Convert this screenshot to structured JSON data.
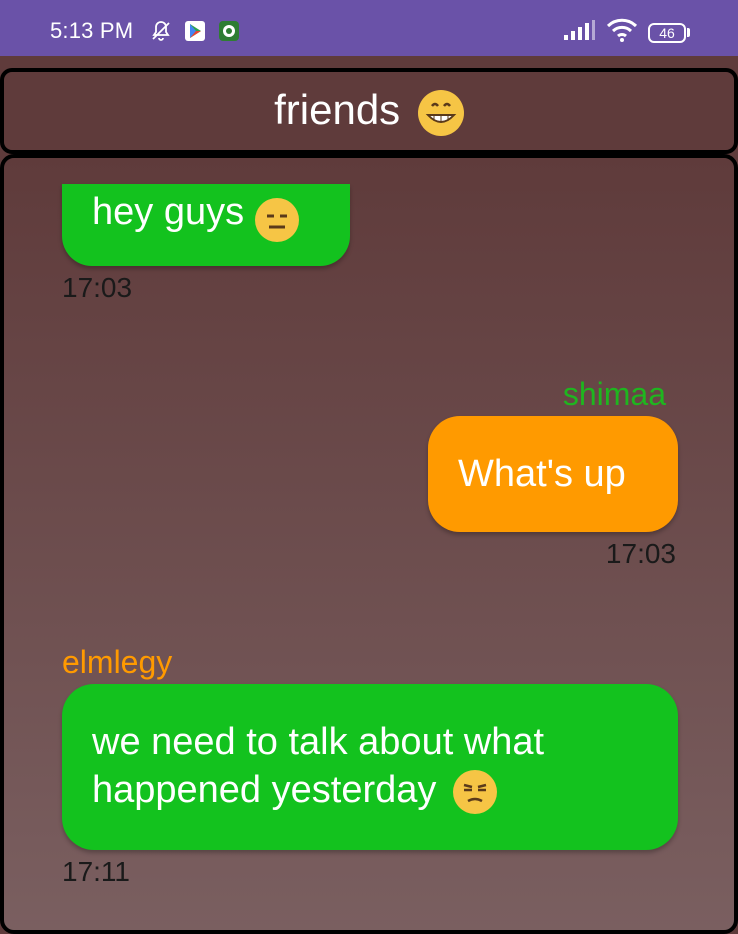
{
  "status_bar": {
    "time": "5:13 PM",
    "battery": "46",
    "icons": [
      "notifications-off-icon",
      "play-store-icon",
      "app-icon",
      "signal-icon",
      "wifi-icon",
      "battery-icon"
    ]
  },
  "header": {
    "title": "friends",
    "emoji": "😁"
  },
  "messages": [
    {
      "sender": "",
      "text": "hey guys",
      "emoji": "😑",
      "time": "17:03",
      "side": "left",
      "color": "#13c21e"
    },
    {
      "sender": "shimaa",
      "text": "What's up",
      "emoji": "",
      "time": "17:03",
      "side": "right",
      "color": "#ff9a00",
      "sender_color": "#1fb51f"
    },
    {
      "sender": "elmlegy",
      "text_line1": "we need to talk about what",
      "text_line2": "happened yesterday",
      "emoji": "😒",
      "time": "17:11",
      "side": "left",
      "color": "#13c21e",
      "sender_color": "#ff9a00"
    }
  ]
}
